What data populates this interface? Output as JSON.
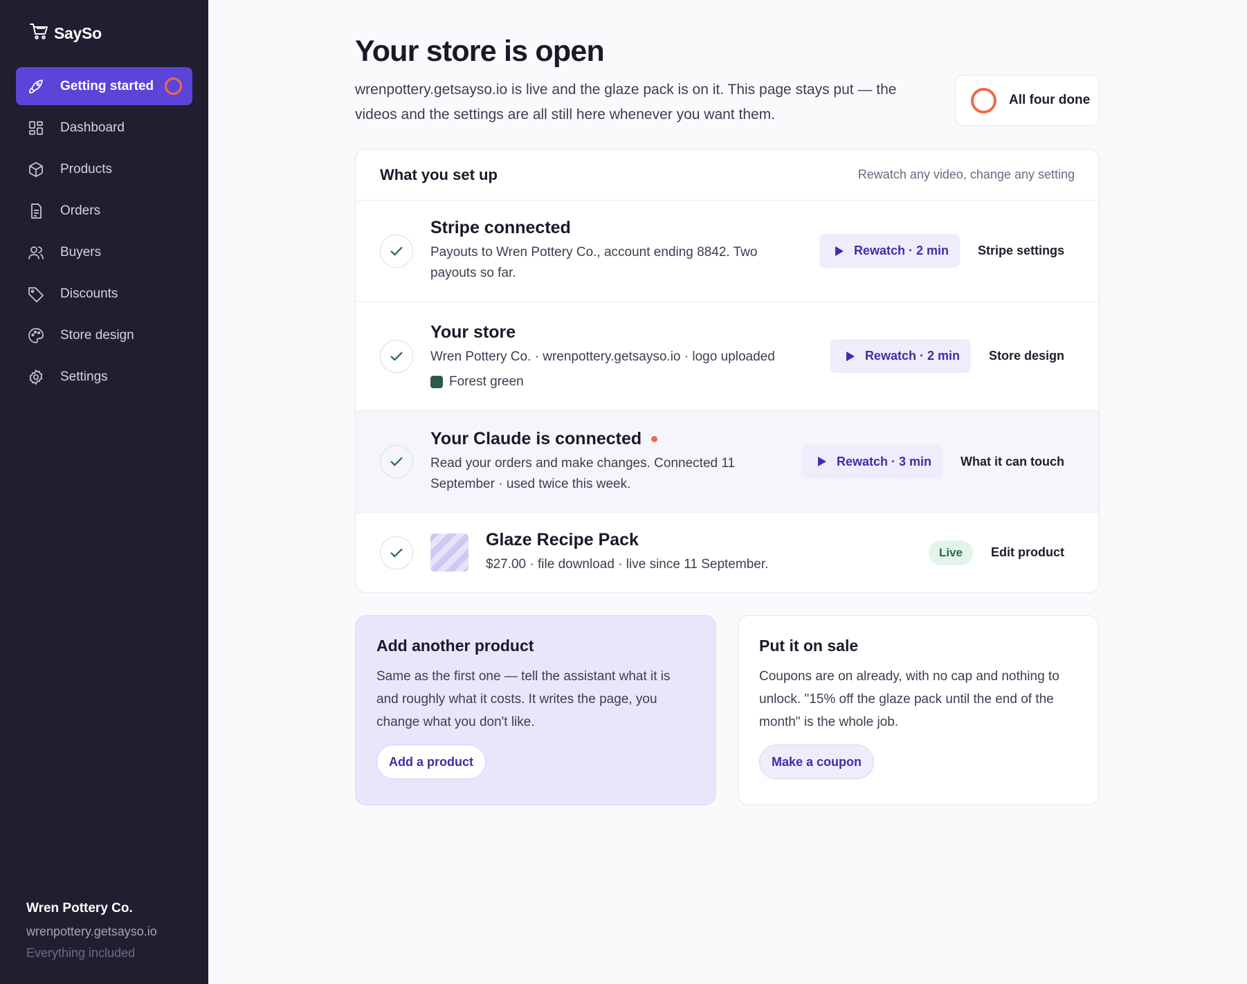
{
  "app": {
    "name": "SaySo"
  },
  "sidebar": {
    "items": [
      {
        "label": "Getting started",
        "icon": "rocket-icon"
      },
      {
        "label": "Dashboard",
        "icon": "grid-icon"
      },
      {
        "label": "Products",
        "icon": "box-icon"
      },
      {
        "label": "Orders",
        "icon": "document-icon"
      },
      {
        "label": "Buyers",
        "icon": "users-icon"
      },
      {
        "label": "Discounts",
        "icon": "tag-icon"
      },
      {
        "label": "Store design",
        "icon": "palette-icon"
      },
      {
        "label": "Settings",
        "icon": "gear-icon"
      }
    ],
    "account": {
      "name": "Wren Pottery Co.",
      "url": "wrenpottery.getsayso.io",
      "plan": "Everything included"
    }
  },
  "header": {
    "title": "Your store is open",
    "subtitle": "wrenpottery.getsayso.io is live and the glaze pack is on it. This page stays put — the videos and the settings are all still here whenever you want them.",
    "status_pill": "All four done"
  },
  "setup_card": {
    "title": "What you set up",
    "hint": "Rewatch any video, change any setting",
    "rows": [
      {
        "title": "Stripe connected",
        "description": "Payouts to Wren Pottery Co., account ending 8842. Two payouts so far.",
        "rewatch": "Rewatch · 2 min",
        "action": "Stripe settings"
      },
      {
        "title": "Your store",
        "description": "Wren Pottery Co. · wrenpottery.getsayso.io · logo uploaded",
        "swatch_label": "Forest green",
        "swatch_color": "#2d5a45",
        "rewatch": "Rewatch · 2 min",
        "action": "Store design"
      },
      {
        "title": "Your Claude is connected",
        "description": "Read your orders and make changes. Connected 11 September · used twice this week.",
        "rewatch": "Rewatch · 3 min",
        "action": "What it can touch"
      },
      {
        "title": "Glaze Recipe Pack",
        "description": "$27.00 · file download · live since 11 September.",
        "badge": "Live",
        "action": "Edit product"
      }
    ]
  },
  "promos": [
    {
      "title": "Add another product",
      "text": "Same as the first one — tell the assistant what it is and roughly what it costs. It writes the page, you change what you don't like.",
      "button": "Add a product"
    },
    {
      "title": "Put it on sale",
      "text": "Coupons are on already, with no cap and nothing to unlock. \"15% off the glaze pack until the end of the month\" is the whole job.",
      "button": "Make a coupon"
    }
  ],
  "colors": {
    "sidebar_bg": "#221d2f",
    "accent": "#5b45d9",
    "progress": "#f06a4a",
    "success": "#2b6a47"
  }
}
